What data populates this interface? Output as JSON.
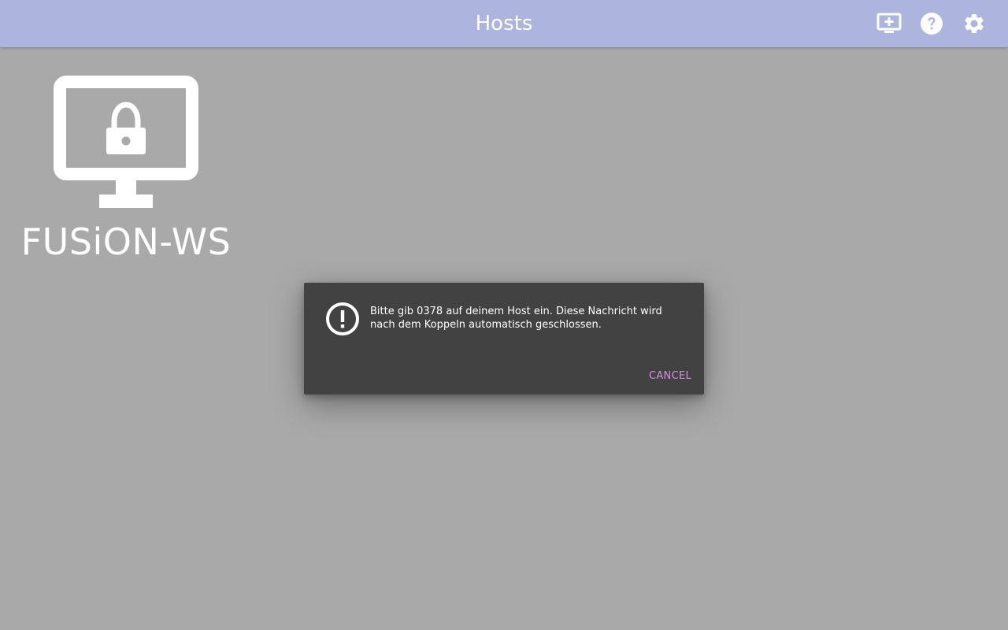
{
  "header": {
    "title": "Hosts",
    "actions": [
      {
        "icon": "add-host-icon"
      },
      {
        "icon": "help-icon"
      },
      {
        "icon": "settings-icon"
      }
    ],
    "background_color": "#adb5df"
  },
  "hosts": [
    {
      "name": "FUSiON-WS",
      "icon": "locked-monitor-icon",
      "state": "locked"
    }
  ],
  "dialog": {
    "icon": "alert-circle-icon",
    "message": "Bitte gib 0378 auf deinem Host ein. Diese Nachricht wird nach dem Koppeln automatisch geschlossen.",
    "cancel_label": "CANCEL",
    "background_color": "#424242",
    "accent_color": "#ce93d8"
  },
  "colors": {
    "backdrop": "#a9a9a9",
    "text": "#ffffff"
  }
}
